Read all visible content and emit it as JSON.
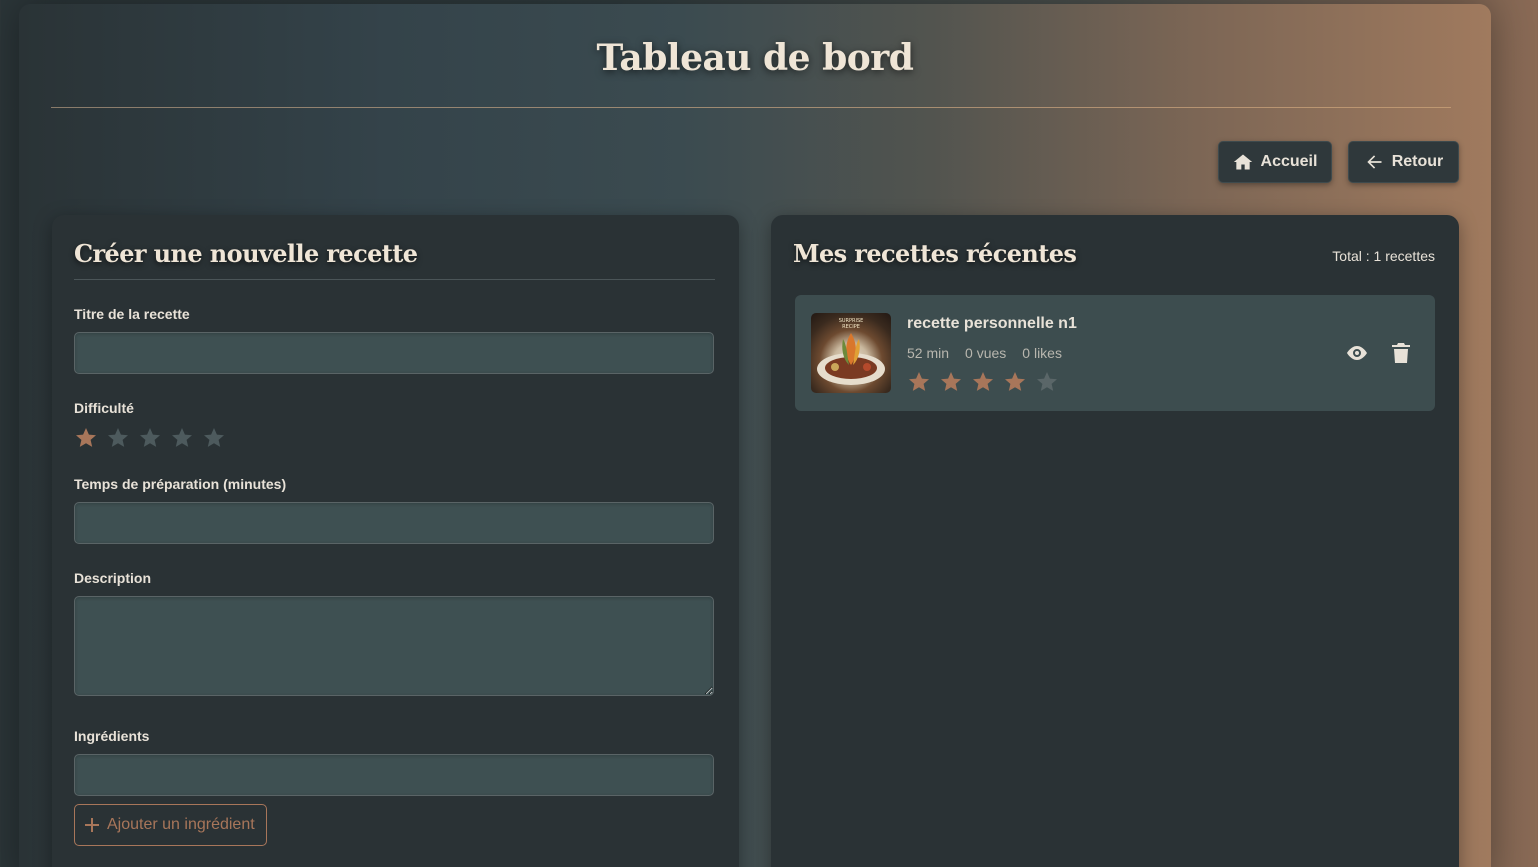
{
  "header": {
    "title": "Tableau de bord",
    "home_label": "Accueil",
    "back_label": "Retour"
  },
  "create_form": {
    "title": "Créer une nouvelle recette",
    "recipe_title_label": "Titre de la recette",
    "recipe_title_value": "",
    "difficulty_label": "Difficulté",
    "difficulty_value": 1,
    "difficulty_max": 5,
    "prep_time_label": "Temps de préparation (minutes)",
    "prep_time_value": "",
    "description_label": "Description",
    "description_value": "",
    "ingredients_label": "Ingrédients",
    "ingredient_value": "",
    "add_ingredient_label": "Ajouter un ingrédient"
  },
  "recent_recipes": {
    "title": "Mes recettes récentes",
    "total": "Total : 1 recettes",
    "items": [
      {
        "name": "recette personnelle n1",
        "time": "52 min",
        "views": "0 vues",
        "likes": "0 likes",
        "rating": 4,
        "rating_max": 5,
        "thumbnail_text": "SURPRISE RECIPE"
      }
    ]
  },
  "colors": {
    "accent": "#a8765a",
    "panel": "#2a3235",
    "input": "#3e5052"
  },
  "icons": {
    "home": "home-icon",
    "back": "arrow-left-icon",
    "star": "star-icon",
    "plus": "plus-icon",
    "view": "eye-icon",
    "delete": "trash-icon"
  }
}
